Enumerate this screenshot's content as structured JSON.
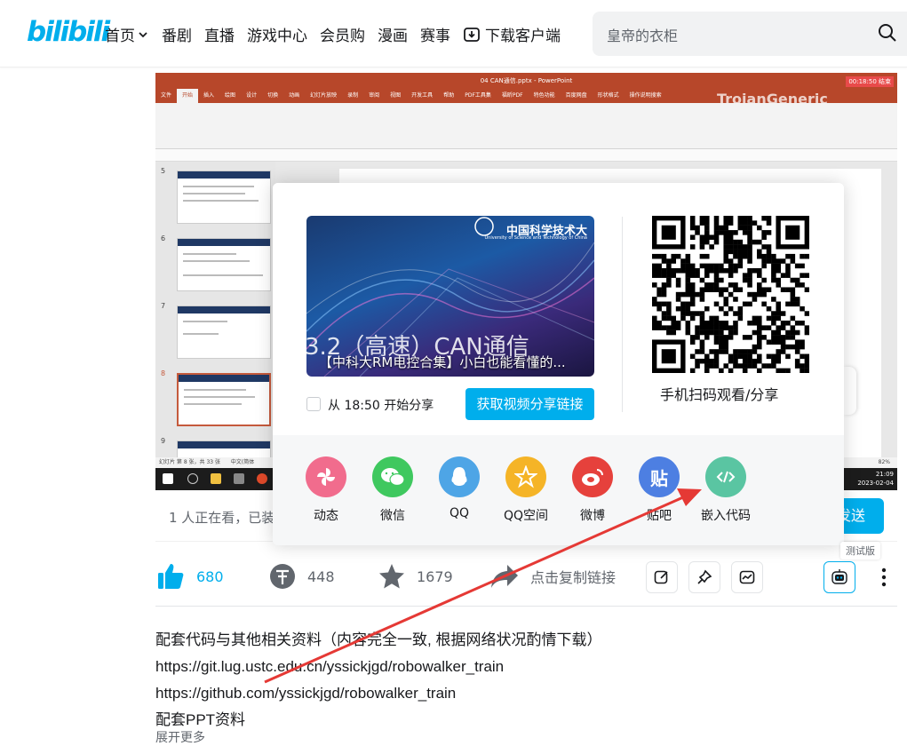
{
  "header": {
    "logo": "bilibili",
    "nav": [
      "首页",
      "番剧",
      "直播",
      "游戏中心",
      "会员购",
      "漫画",
      "赛事",
      "下载客户端"
    ],
    "search_placeholder": "皇帝的衣柜"
  },
  "player": {
    "pp_title": "04 CAN通信.pptx - PowerPoint",
    "pp_tabs": [
      "文件",
      "开始",
      "插入",
      "绘图",
      "设计",
      "切换",
      "动画",
      "幻灯片放映",
      "录制",
      "审阅",
      "视图",
      "开发工具",
      "帮助",
      "PDF工具集",
      "福昕PDF",
      "特色功能",
      "百度网盘",
      "形状格式",
      "操作说明搜索"
    ],
    "watermark": "TrojanGeneric",
    "rec_time": "00:18:50 结束",
    "slide_numbers": [
      "5",
      "6",
      "7",
      "8",
      "9"
    ],
    "status": "幻灯片 第 8 张，共 33 张",
    "language": "中文(简体",
    "zoom": "82%",
    "time": "21:09",
    "date": "2023-02-04"
  },
  "viewers_text": "1 人正在看，已装",
  "send_label": "发送",
  "share_popup": {
    "ustc_name": "中国科学技术大",
    "ustc_sub": "University of Science and Technology of China",
    "big_title": "3.2（高速）CAN通信",
    "video_title": "【中科大RM电控合集】小白也能看懂的...",
    "start_from": "从 18:50 开始分享",
    "get_link": "获取视频分享链接",
    "qr_caption": "手机扫码观看/分享",
    "targets": [
      {
        "label": "动态",
        "color": "#f16c8d",
        "icon": "dynamic-icon"
      },
      {
        "label": "微信",
        "color": "#3fc85f",
        "icon": "wechat-icon"
      },
      {
        "label": "QQ",
        "color": "#4ea5e6",
        "icon": "qq-icon"
      },
      {
        "label": "QQ空间",
        "color": "#f5b427",
        "icon": "qzone-icon"
      },
      {
        "label": "微博",
        "color": "#e6413c",
        "icon": "weibo-icon"
      },
      {
        "label": "贴吧",
        "color": "#4d7fe2",
        "icon": "tieba-icon"
      },
      {
        "label": "嵌入代码",
        "color": "#5ac5a2",
        "icon": "embed-code-icon"
      }
    ]
  },
  "test_badge": "测试版",
  "toolbar": {
    "likes": "680",
    "coins": "448",
    "favorites": "1679",
    "copy_link": "点击复制链接"
  },
  "description": [
    "配套代码与其他相关资料（内容完全一致, 根据网络状况酌情下载）",
    "https://git.lug.ustc.edu.cn/yssickjgd/robowalker_train",
    "https://github.com/yssickjgd/robowalker_train",
    "配套PPT资料"
  ],
  "expand": "展开更多"
}
